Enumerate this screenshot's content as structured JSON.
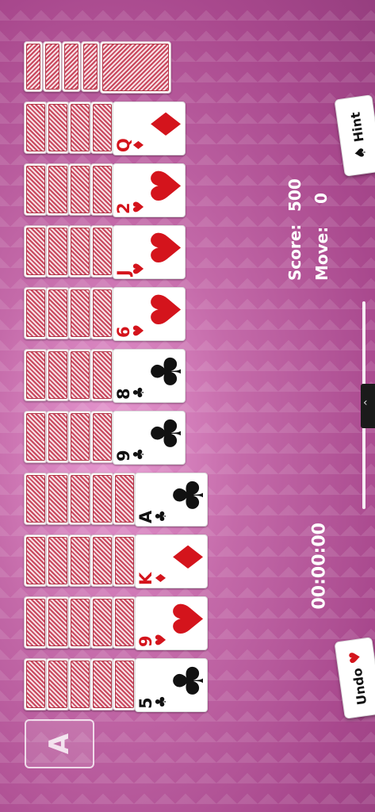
{
  "colors": {
    "red": "#d4141c",
    "black": "#111111",
    "background": "#b85a9b"
  },
  "stats": {
    "score_label": "Score:",
    "score_value": "500",
    "moves_label": "Move:",
    "moves_value": "0",
    "timer": "00:00:00"
  },
  "buttons": {
    "hint_label": "Hint",
    "hint_icon": "spade-icon",
    "undo_label": "Undo",
    "undo_icon": "heart-icon"
  },
  "foundation": {
    "label": "A"
  },
  "columns": [
    {
      "rank": "Q",
      "suit": "♦",
      "color": "red",
      "hidden": 4
    },
    {
      "rank": "2",
      "suit": "♥",
      "color": "red",
      "hidden": 4
    },
    {
      "rank": "J",
      "suit": "♥",
      "color": "red",
      "hidden": 4
    },
    {
      "rank": "6",
      "suit": "♥",
      "color": "red",
      "hidden": 4
    },
    {
      "rank": "8",
      "suit": "♣",
      "color": "black",
      "hidden": 4
    },
    {
      "rank": "9",
      "suit": "♣",
      "color": "black",
      "hidden": 4
    },
    {
      "rank": "A",
      "suit": "♣",
      "color": "black",
      "hidden": 5
    },
    {
      "rank": "K",
      "suit": "♦",
      "color": "red",
      "hidden": 5
    },
    {
      "rank": "9",
      "suit": "♥",
      "color": "red",
      "hidden": 5
    },
    {
      "rank": "5",
      "suit": "♣",
      "color": "black",
      "hidden": 5
    }
  ],
  "stock": {
    "count": 5
  }
}
